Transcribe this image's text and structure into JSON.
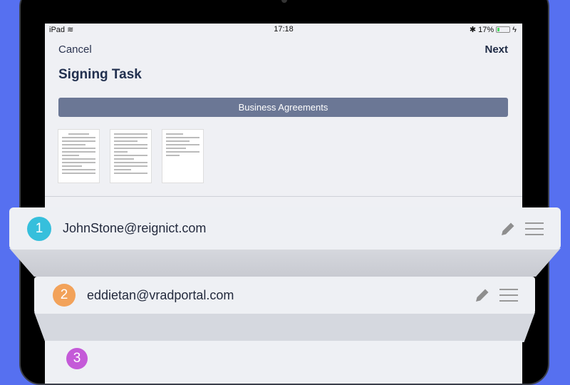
{
  "status_bar": {
    "device": "iPad",
    "time": "17:18",
    "battery": "17%",
    "battery_level": 0.17
  },
  "nav": {
    "cancel": "Cancel",
    "next": "Next"
  },
  "title": "Signing Task",
  "document_group": "Business Agreements",
  "documents_count": 3,
  "signers": [
    {
      "order": "1",
      "email": "JohnStone@reignict.com",
      "color": "#36bfdc"
    },
    {
      "order": "2",
      "email": "eddietan@vradportal.com",
      "color": "#f2a25a"
    },
    {
      "order": "3",
      "color": "#c45ad8"
    }
  ]
}
